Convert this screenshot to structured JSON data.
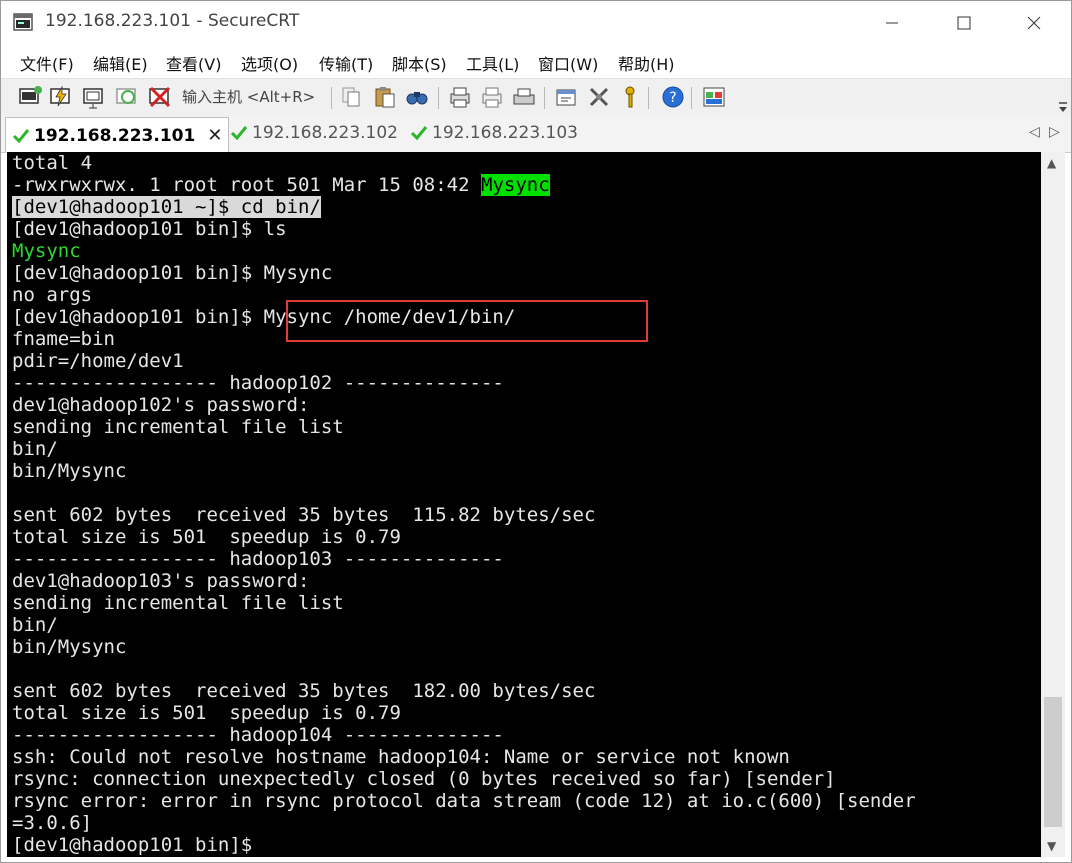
{
  "window": {
    "title": "192.168.223.101 - SecureCRT"
  },
  "menu": [
    "文件(F)",
    "编辑(E)",
    "查看(V)",
    "选项(O)",
    "传输(T)",
    "脚本(S)",
    "工具(L)",
    "窗口(W)",
    "帮助(H)"
  ],
  "toolbar": {
    "connect_placeholder": "输入主机 <Alt+R>"
  },
  "tabs": [
    {
      "label": "192.168.223.101",
      "active": true
    },
    {
      "label": "192.168.223.102",
      "active": false
    },
    {
      "label": "192.168.223.103",
      "active": false
    }
  ],
  "terminal": {
    "lines": [
      "total 4",
      "-rwxrwxrwx. 1 root root 501 Mar 15 08:42 ",
      "[dev1@hadoop101 ~]$ cd bin/",
      "[dev1@hadoop101 bin]$ ls",
      "Mysync",
      "[dev1@hadoop101 bin]$ Mysync",
      "no args",
      "[dev1@hadoop101 bin]$ Mysync /home/dev1/bin/",
      "fname=bin",
      "pdir=/home/dev1",
      "------------------ hadoop102 --------------",
      "dev1@hadoop102's password:",
      "sending incremental file list",
      "bin/",
      "bin/Mysync",
      "",
      "sent 602 bytes  received 35 bytes  115.82 bytes/sec",
      "total size is 501  speedup is 0.79",
      "------------------ hadoop103 --------------",
      "dev1@hadoop103's password:",
      "sending incremental file list",
      "bin/",
      "bin/Mysync",
      "",
      "sent 602 bytes  received 35 bytes  182.00 bytes/sec",
      "total size is 501  speedup is 0.79",
      "------------------ hadoop104 --------------",
      "ssh: Could not resolve hostname hadoop104: Name or service not known",
      "rsync: connection unexpectedly closed (0 bytes received so far) [sender]",
      "rsync error: error in rsync protocol data stream (code 12) at io.c(600) [sender",
      "=3.0.6]",
      "[dev1@hadoop101 bin]$ "
    ],
    "ls_highlight": "Mysync"
  },
  "colors": {
    "terminal_bg": "#000000",
    "terminal_fg": "#e6e6e6",
    "exec_green": "#00e000",
    "annotation_red": "#e03a3a"
  }
}
